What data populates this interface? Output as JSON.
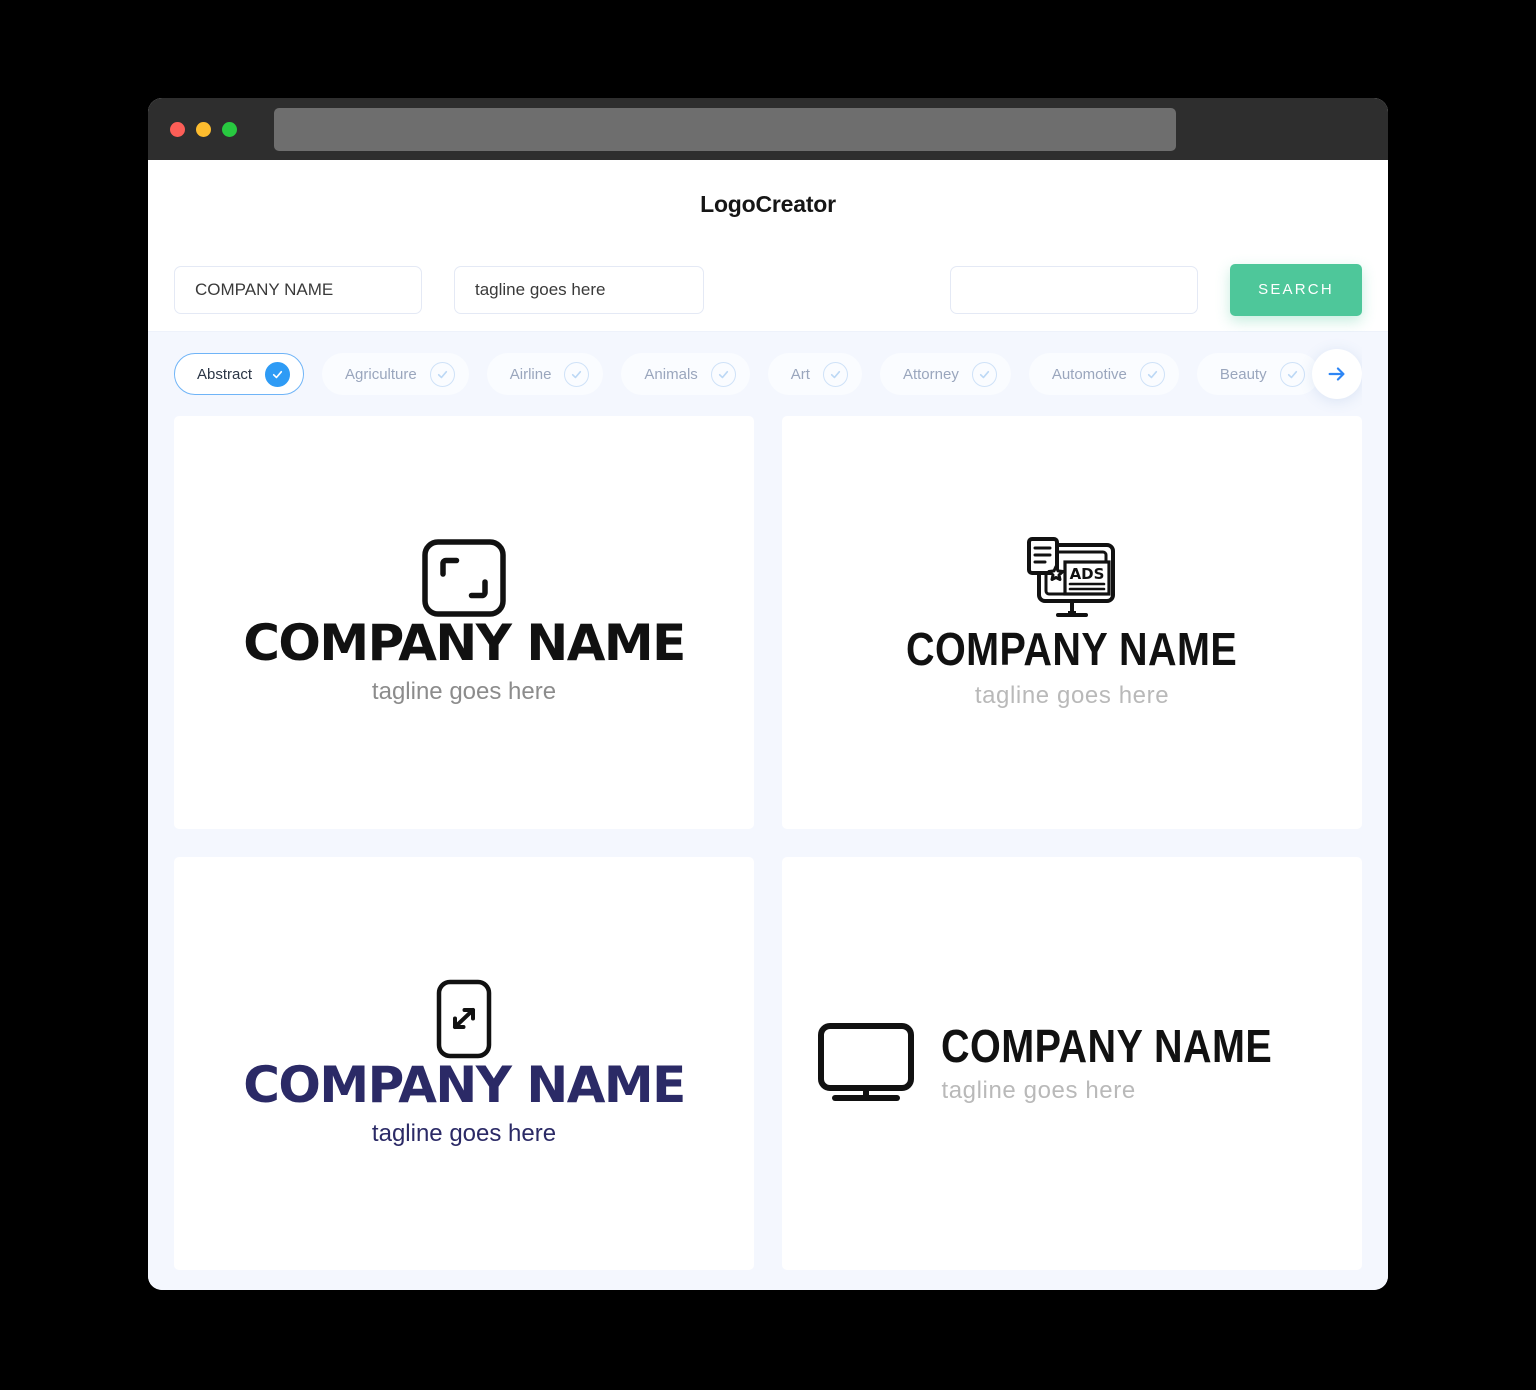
{
  "window": {
    "traffic_lights": [
      {
        "name": "close",
        "color": "#fc5e57"
      },
      {
        "name": "minimize",
        "color": "#fdbc2e"
      },
      {
        "name": "maximize",
        "color": "#28c940"
      }
    ],
    "url_value": ""
  },
  "header": {
    "title": "LogoCreator"
  },
  "search": {
    "company_value": "COMPANY NAME",
    "company_placeholder": "COMPANY NAME",
    "tagline_value": "tagline goes here",
    "tagline_placeholder": "tagline goes here",
    "extra_value": "",
    "extra_placeholder": "",
    "search_label": "SEARCH",
    "button_color": "#4ec79a"
  },
  "categories": {
    "next_icon": "arrow-right-icon",
    "accent_color": "#2e9bf5",
    "items": [
      {
        "label": "Abstract",
        "selected": true
      },
      {
        "label": "Agriculture",
        "selected": false
      },
      {
        "label": "Airline",
        "selected": false
      },
      {
        "label": "Animals",
        "selected": false
      },
      {
        "label": "Art",
        "selected": false
      },
      {
        "label": "Attorney",
        "selected": false
      },
      {
        "label": "Automotive",
        "selected": false
      },
      {
        "label": "Beauty",
        "selected": false
      }
    ]
  },
  "logos": [
    {
      "id": "logo-1",
      "icon": "rounded-square-crop-brackets-icon",
      "name": "COMPANY NAME",
      "tagline": "tagline goes here",
      "name_color": "#111111",
      "tagline_color": "#8c8c8c",
      "layout": "stacked"
    },
    {
      "id": "logo-2",
      "icon": "monitor-ads-icon",
      "badge_text": "ADS",
      "name": "COMPANY NAME",
      "tagline": "tagline goes here",
      "name_color": "#111111",
      "tagline_color": "#b9b9b9",
      "layout": "stacked"
    },
    {
      "id": "logo-3",
      "icon": "phone-diagonal-arrows-icon",
      "name": "COMPANY NAME",
      "tagline": "tagline goes here",
      "name_color": "#2b2a66",
      "tagline_color": "#6a6aa8",
      "layout": "stacked"
    },
    {
      "id": "logo-4",
      "icon": "monitor-icon",
      "name": "COMPANY NAME",
      "tagline": "tagline goes here",
      "name_color": "#111111",
      "tagline_color": "#b9b9b9",
      "layout": "inline"
    }
  ]
}
